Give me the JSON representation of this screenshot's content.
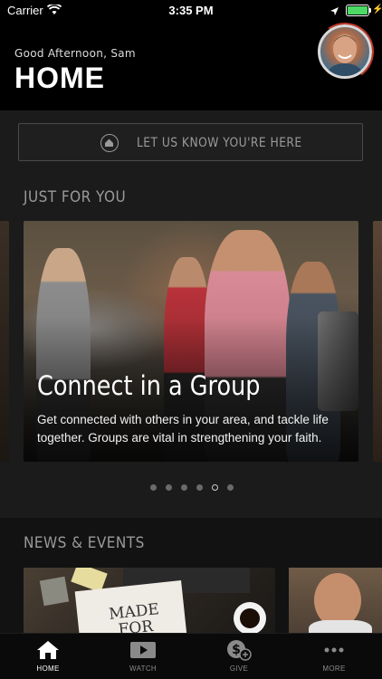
{
  "status_bar": {
    "carrier": "Carrier",
    "time": "3:35 PM",
    "battery_level": 1.0,
    "battery_color": "#4cd964",
    "icons": [
      "wifi-icon",
      "location-arrow-icon",
      "battery-icon",
      "charging-bolt-icon"
    ]
  },
  "header": {
    "greeting": "Good Afternoon,  Sam",
    "title": "HOME",
    "avatar": "profile-photo"
  },
  "checkin": {
    "label": "LET US KNOW YOU'RE HERE",
    "icon": "home-icon"
  },
  "just_for_you": {
    "title": "JUST FOR YOU",
    "featured": {
      "title": "Connect in a Group",
      "description": "Get connected with others in your area, and tackle life together. Groups are vital in strengthening your faith."
    },
    "pagination": {
      "count": 6,
      "active_index": 4
    }
  },
  "news_events": {
    "title": "NEWS & EVENTS",
    "card1_text": "MADE FOR"
  },
  "tabs": [
    {
      "label": "HOME",
      "icon": "home-icon",
      "active": true
    },
    {
      "label": "WATCH",
      "icon": "play-video-icon",
      "active": false
    },
    {
      "label": "GIVE",
      "icon": "give-dollar-icon",
      "active": false
    },
    {
      "label": "MORE",
      "icon": "more-dots-icon",
      "active": false
    }
  ],
  "colors": {
    "background": "#000000",
    "surface": "#1b1b1b",
    "muted_text": "#9a9a9a",
    "accent_ring": "#c0392b"
  }
}
